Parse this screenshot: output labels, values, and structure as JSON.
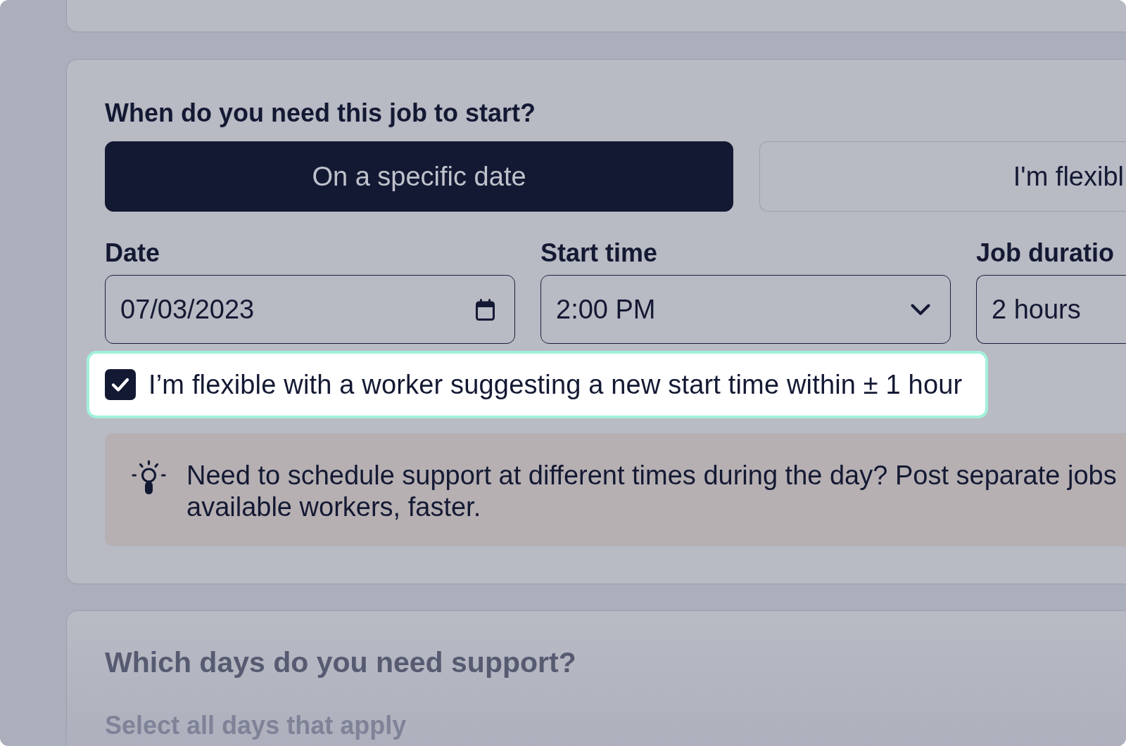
{
  "start_section": {
    "title": "When do you need this job to start?",
    "options": [
      {
        "label": "On a specific date",
        "selected": true
      },
      {
        "label": "I'm flexibl",
        "selected": false
      }
    ],
    "fields": [
      {
        "label": "Date",
        "kind": "date",
        "value": "07/03/2023"
      },
      {
        "label": "Start time",
        "kind": "select",
        "value": "2:00 PM"
      },
      {
        "label": "Job duratio",
        "kind": "plain",
        "value": "2 hours"
      }
    ],
    "flexible_time": {
      "label": "I’m flexible with a worker suggesting a new start time within ± 1 hour",
      "checked": true,
      "highlighted": true
    },
    "tip": {
      "lines": [
        "Need to schedule support at different times during the day? Post separate jobs",
        "available workers, faster."
      ]
    }
  },
  "days_section": {
    "title": "Which days do you need support?",
    "hint": "Select all days that apply"
  }
}
